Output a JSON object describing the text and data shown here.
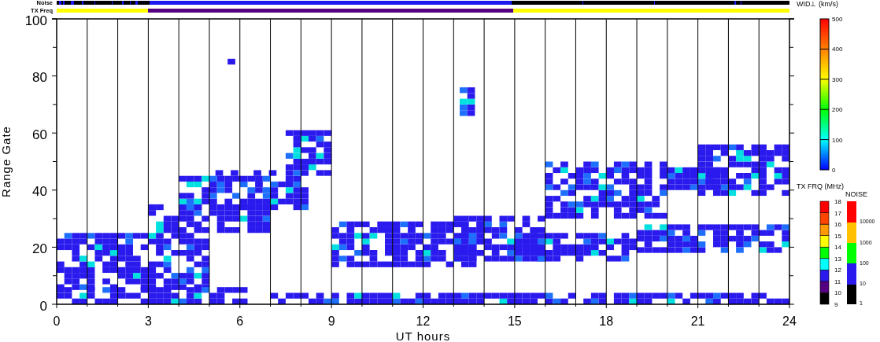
{
  "top_strips": [
    {
      "label": "Noise"
    },
    {
      "label": "TX Freq"
    }
  ],
  "plot": {
    "y_axis": {
      "label": "Range Gate",
      "ticks": [
        "100",
        "80",
        "60",
        "40",
        "20",
        "0"
      ]
    },
    "x_axis": {
      "label": "UT hours",
      "ticks": [
        "0",
        "3",
        "6",
        "9",
        "12",
        "15",
        "18",
        "21",
        "24"
      ]
    }
  },
  "colorbars": [
    {
      "kind": "gradient",
      "title": "WID⊥ (km/s)",
      "labels": [
        "500",
        "400",
        "300",
        "200",
        "100",
        "0"
      ]
    },
    {
      "kind": "freq",
      "title": "TX FRQ (MHz)",
      "labels": [
        "18",
        "17",
        "16",
        "15",
        "14",
        "13",
        "12",
        "11",
        "10",
        "9"
      ]
    },
    {
      "kind": "noise",
      "title": "NOISE",
      "labels": [
        "10000",
        "1000",
        "100",
        "10",
        "1"
      ]
    }
  ]
}
